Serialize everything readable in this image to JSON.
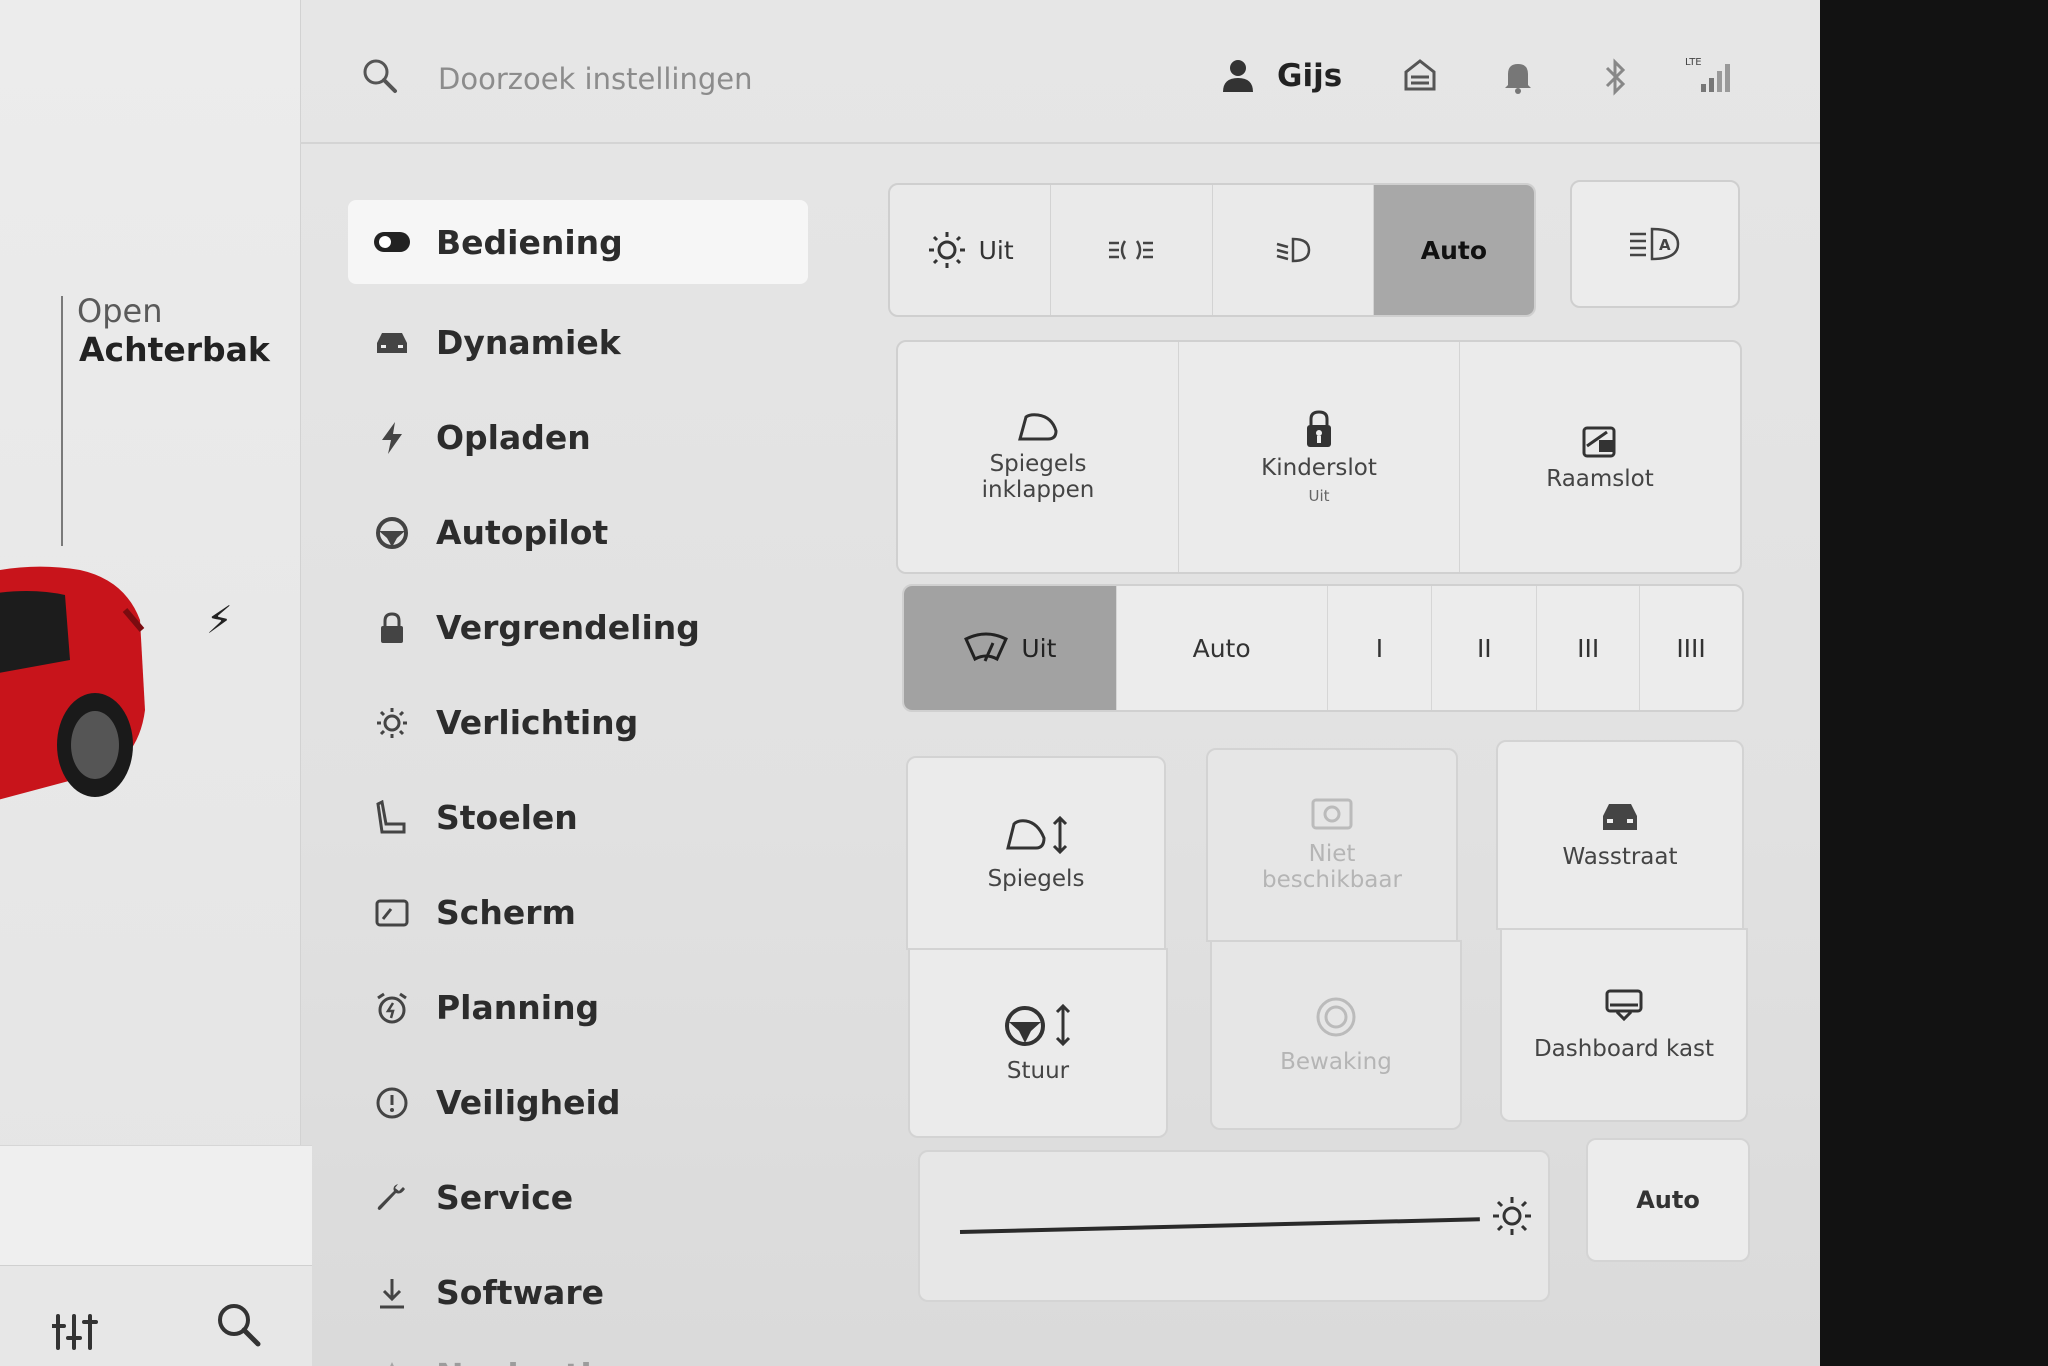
{
  "top_bar": {
    "search_placeholder": "Doorzoek instellingen",
    "profile_name": "Gijs",
    "network": "LTE"
  },
  "car_panel": {
    "trunk_open_label": "Open",
    "trunk_name": "Achterbak",
    "car_color": "#c8141b"
  },
  "nav": {
    "items": [
      {
        "label": "Bediening",
        "icon": "toggle-icon",
        "active": true
      },
      {
        "label": "Dynamiek",
        "icon": "car-icon"
      },
      {
        "label": "Opladen",
        "icon": "bolt-icon"
      },
      {
        "label": "Autopilot",
        "icon": "steering-wheel-icon"
      },
      {
        "label": "Vergrendeling",
        "icon": "lock-icon"
      },
      {
        "label": "Verlichting",
        "icon": "sun-icon"
      },
      {
        "label": "Stoelen",
        "icon": "seat-icon"
      },
      {
        "label": "Scherm",
        "icon": "display-icon"
      },
      {
        "label": "Planning",
        "icon": "alarm-icon"
      },
      {
        "label": "Veiligheid",
        "icon": "alert-icon"
      },
      {
        "label": "Service",
        "icon": "wrench-icon"
      },
      {
        "label": "Software",
        "icon": "download-icon"
      },
      {
        "label": "Navigatie",
        "icon": "navigation-icon"
      }
    ]
  },
  "lights": {
    "off_label": "Uit",
    "auto_label": "Auto",
    "selected": "Auto"
  },
  "quick_controls": {
    "mirrors_fold": "Spiegels inklappen",
    "child_lock": "Kinderslot",
    "child_lock_state": "Uit",
    "window_lock": "Raamslot"
  },
  "wipers": {
    "off_label": "Uit",
    "auto_label": "Auto",
    "speeds": [
      "I",
      "II",
      "III",
      "IIII"
    ],
    "selected": "Uit"
  },
  "adjust": {
    "mirrors": "Spiegels",
    "steering": "Stuur",
    "unavailable": "Niet beschikbaar",
    "sentry": "Bewaking",
    "car_wash": "Wasstraat",
    "glovebox": "Dashboard kast"
  },
  "display": {
    "auto_label": "Auto"
  },
  "colors": {
    "selected_segment": "#a8a8a8",
    "background": "#e3e3e3"
  }
}
